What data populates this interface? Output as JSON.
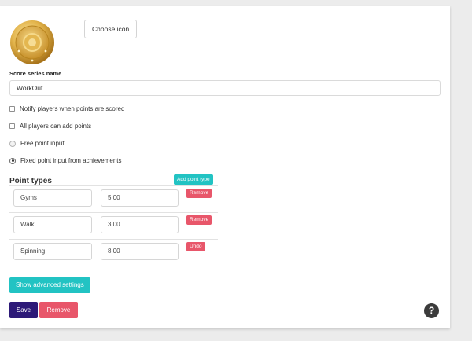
{
  "icon": {
    "choose_label": "Choose icon",
    "image_name": "gold-coin-icon",
    "colors": {
      "gold": "#d9a53a",
      "gold_light": "#f3d37a",
      "gold_dark": "#b07c1e"
    }
  },
  "series": {
    "label": "Score series name",
    "value": "WorkOut"
  },
  "options": {
    "notify": "Notify players when points are scored",
    "all_players": "All players can add points",
    "free_input": "Free point input",
    "fixed_input": "Fixed point input from achievements",
    "selected": "fixed_input"
  },
  "point_types": {
    "heading": "Point types",
    "add_label": "Add point type",
    "rows": [
      {
        "name": "Gyms",
        "value": "5.00",
        "action": "Remove",
        "struck": false
      },
      {
        "name": "Walk",
        "value": "3.00",
        "action": "Remove",
        "struck": false
      },
      {
        "name": "Spinning",
        "value": "8.00",
        "action": "Undo",
        "struck": true
      }
    ]
  },
  "advanced_label": "Show advanced settings",
  "footer": {
    "save_label": "Save",
    "remove_label": "Remove",
    "help_glyph": "?"
  },
  "colors": {
    "teal": "#22c3c3",
    "red": "#e8566a",
    "purple": "#2d1a78"
  }
}
